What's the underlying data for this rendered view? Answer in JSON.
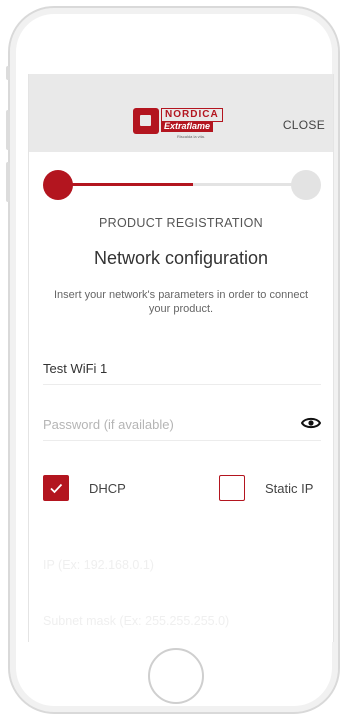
{
  "header": {
    "logo": {
      "brand_top": "NORDICA",
      "brand_main": "Extraflame",
      "tagline": "Riscalda la vita."
    },
    "close_label": "CLOSE"
  },
  "progress": {
    "current_step": 1,
    "total_steps": 2,
    "fill_fraction": 0.55
  },
  "step_label": "PRODUCT REGISTRATION",
  "title": "Network configuration",
  "description": "Insert your network's parameters in order to connect your product.",
  "form": {
    "ssid": {
      "value": "Test WiFi 1"
    },
    "password": {
      "placeholder": "Password (if available)"
    },
    "dhcp": {
      "label": "DHCP",
      "checked": true
    },
    "static_ip": {
      "label": "Static IP",
      "checked": false
    },
    "ip": {
      "placeholder": "IP (Ex: 192.168.0.1)"
    },
    "subnet": {
      "placeholder": "Subnet mask (Ex: 255.255.255.0)"
    }
  },
  "colors": {
    "accent": "#b3151f",
    "header_bg": "#e9e9e9",
    "track": "#e3e3e3"
  }
}
